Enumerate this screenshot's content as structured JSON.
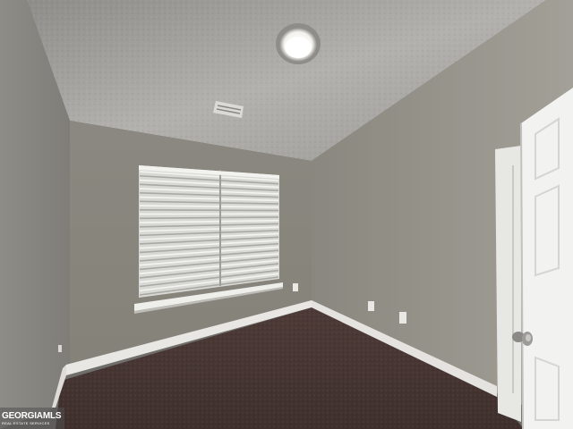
{
  "scene": {
    "description_type": "photo",
    "colors": {
      "ceiling": "#a9a7a3",
      "left_wall": "#8f8d88",
      "back_wall": "#8a877f",
      "right_wall": "#9a978f",
      "carpet": "#4b3a37",
      "trim": "#ecebe8",
      "door": "#f1f1ef",
      "blinds": "#e3e3e0"
    },
    "icons": [
      "ceiling-light-icon",
      "air-vent-icon",
      "door-knob-icon"
    ]
  },
  "watermark": {
    "brand": "GEORGIAMLS",
    "tagline": "REAL ESTATE SERVICES"
  }
}
